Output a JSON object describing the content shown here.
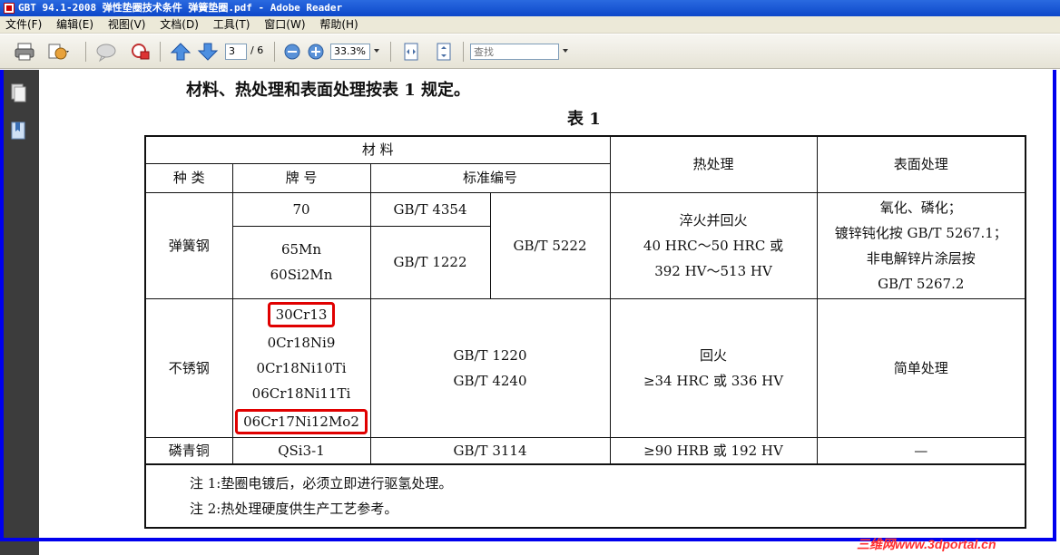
{
  "window": {
    "title": "GBT 94.1-2008 弹性垫圈技术条件  弹簧垫圈.pdf - Adobe Reader"
  },
  "menu": {
    "items": [
      "文件(F)",
      "编辑(E)",
      "视图(V)",
      "文档(D)",
      "工具(T)",
      "窗口(W)",
      "帮助(H)"
    ]
  },
  "toolbar": {
    "page_current": "3",
    "page_total": "/ 6",
    "zoom": "33.3%",
    "search_placeholder": "查找"
  },
  "document": {
    "intro": "材料、热处理和表面处理按表 1 规定。",
    "table_title": "表  1",
    "headers": {
      "material": "材    料",
      "kind": "种  类",
      "grade": "牌    号",
      "standard": "标准编号",
      "heat": "热处理",
      "surface": "表面处理"
    },
    "spring_steel": {
      "kind": "弹簧钢",
      "grade_1": "70",
      "std_1": "GB/T 4354",
      "grade_2a": "65Mn",
      "grade_2b": "60Si2Mn",
      "std_2": "GB/T 1222",
      "std_shared": "GB/T 5222",
      "heat_1": "淬火并回火",
      "heat_2": "40 HRC～50 HRC 或",
      "heat_3": "392 HV～513 HV",
      "surface_1": "氧化、磷化；",
      "surface_2": "镀锌钝化按 GB/T 5267.1；",
      "surface_3": "非电解锌片涂层按",
      "surface_4": "GB/T 5267.2"
    },
    "stainless": {
      "kind": "不锈钢",
      "grades": [
        "30Cr13",
        "0Cr18Ni9",
        "0Cr18Ni10Ti",
        "06Cr18Ni11Ti",
        "06Cr17Ni12Mo2"
      ],
      "std_1": "GB/T 1220",
      "std_2": "GB/T 4240",
      "heat_1": "回火",
      "heat_2": "≥34 HRC 或 336 HV",
      "surface": "简单处理"
    },
    "bronze": {
      "kind": "磷青铜",
      "grade": "QSi3-1",
      "std": "GB/T 3114",
      "heat": "≥90 HRB 或 192 HV",
      "surface": "—"
    },
    "notes": [
      "注 1:垫圈电镀后，必须立即进行驱氢处理。",
      "注 2:热处理硬度供生产工艺参考。"
    ]
  },
  "watermark": "三维网www.3dportal.cn",
  "colors": {
    "titlebar": "#0d47c9",
    "highlight_box": "#e00000",
    "border_frame": "#0000ee"
  }
}
